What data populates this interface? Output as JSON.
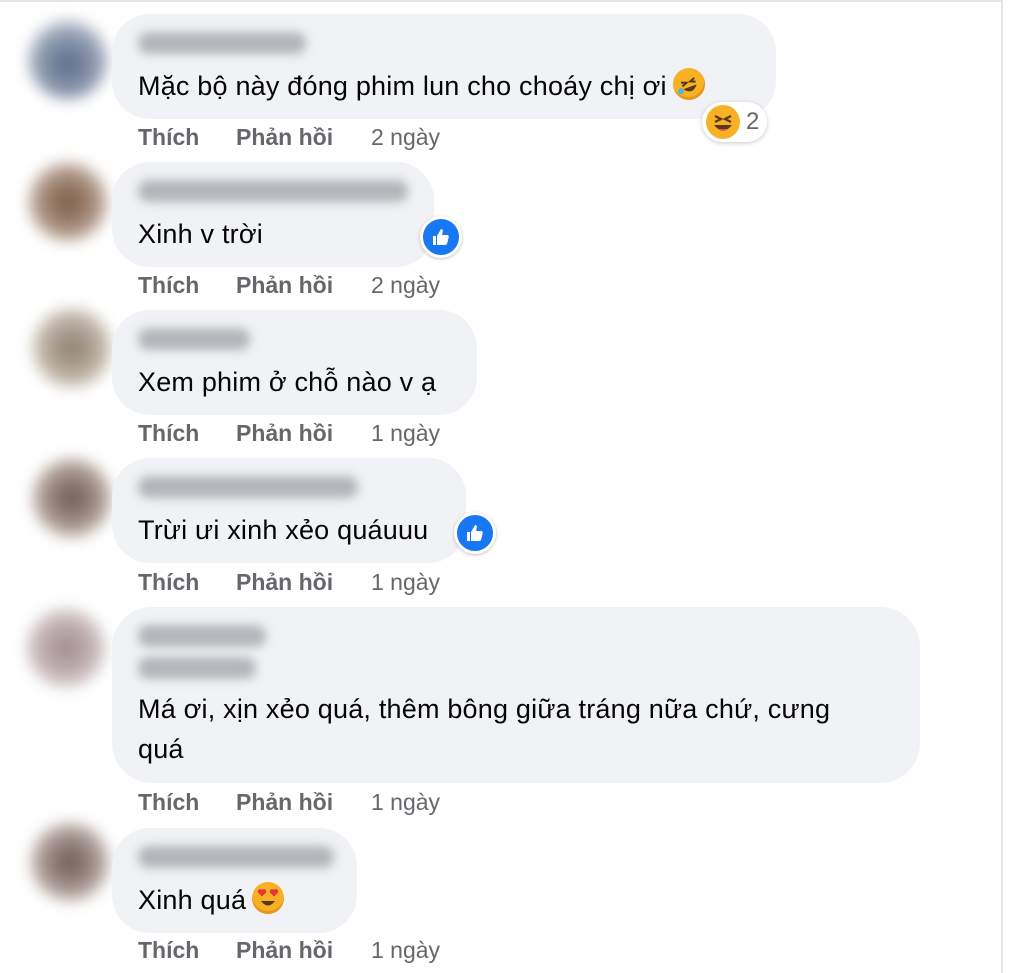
{
  "colors": {
    "bubble_bg": "#f0f2f5",
    "text": "#050505",
    "meta": "#65676b",
    "like_blue": "#1877f2",
    "emoji_yellow": "#f7b125"
  },
  "comments": [
    {
      "text": "Mặc bộ này đóng phim lun cho choáy chị ơi",
      "trailing_emoji": "rolling-on-floor-laughing-icon",
      "reaction": {
        "icon": "laughing-squint-icon",
        "count": "2"
      },
      "actions": {
        "like": "Thích",
        "reply": "Phản hồi",
        "time": "2 ngày"
      }
    },
    {
      "text": "Xinh v trời",
      "reaction": {
        "icon": "like-icon"
      },
      "actions": {
        "like": "Thích",
        "reply": "Phản hồi",
        "time": "2 ngày"
      }
    },
    {
      "text": "Xem phim ở chỗ nào v ạ",
      "actions": {
        "like": "Thích",
        "reply": "Phản hồi",
        "time": "1 ngày"
      }
    },
    {
      "text": "Trừi ưi xinh xẻo quáuuu",
      "reaction": {
        "icon": "like-icon"
      },
      "actions": {
        "like": "Thích",
        "reply": "Phản hồi",
        "time": "1 ngày"
      }
    },
    {
      "text_line1": "Má ơi, xịn xẻo quá, thêm bông giữa tráng nữa chứ, cưng",
      "text_line2": "quá",
      "actions": {
        "like": "Thích",
        "reply": "Phản hồi",
        "time": "1 ngày"
      }
    },
    {
      "text": "Xinh quá",
      "trailing_emoji": "heart-eyes-icon",
      "actions": {
        "like": "Thích",
        "reply": "Phản hồi",
        "time": "1 ngày"
      }
    }
  ]
}
